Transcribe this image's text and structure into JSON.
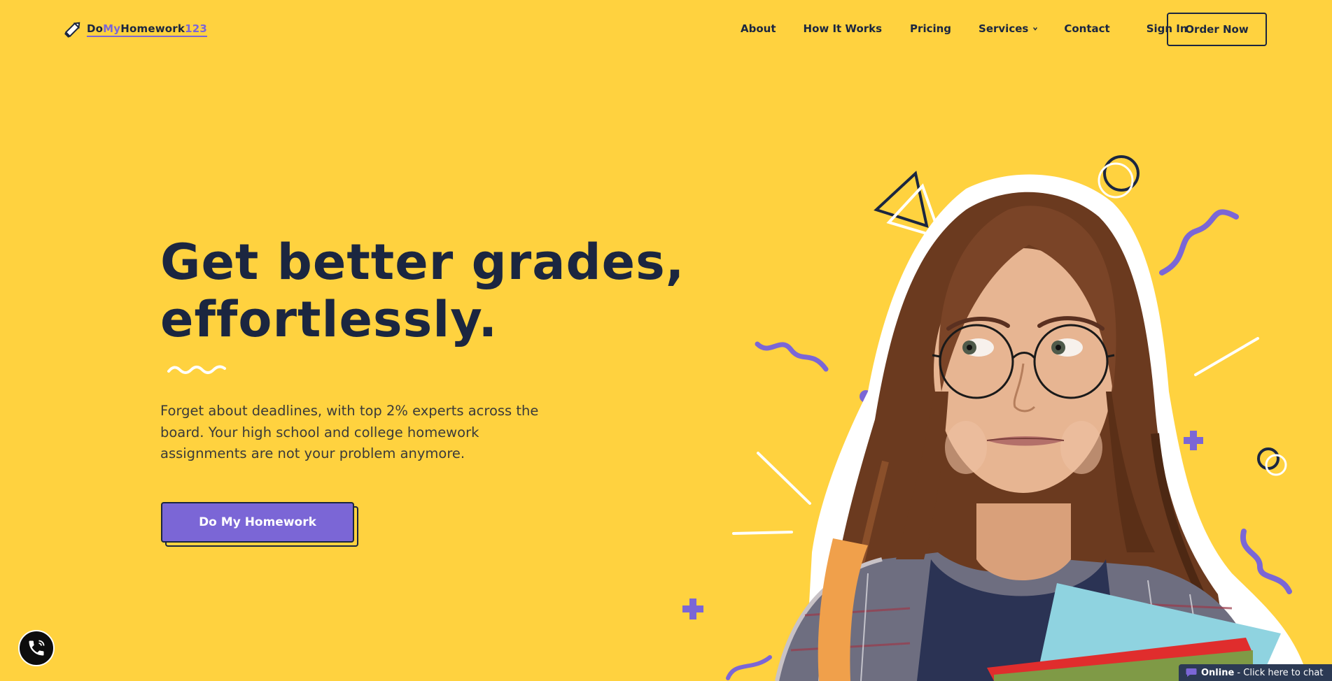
{
  "brand": {
    "part1": "Do",
    "part2": "My",
    "part3": "Homework",
    "part4": "123",
    "icon": "pencil-icon"
  },
  "nav": {
    "about": "About",
    "how": "How It Works",
    "pricing": "Pricing",
    "services": "Services",
    "contact": "Contact",
    "signin": "Sign In",
    "order": "Order Now"
  },
  "hero": {
    "title_line1": "Get better grades,",
    "title_line2": "effortlessly.",
    "subtitle": "Forget about deadlines, with top 2% experts across the board. Your high school and college homework assignments are not your problem anymore.",
    "cta": "Do My Homework"
  },
  "chat": {
    "status": "Online",
    "label": " - Click here to chat"
  },
  "colors": {
    "background": "#ffd23f",
    "accent": "#7b66d6",
    "text": "#1b2640"
  }
}
